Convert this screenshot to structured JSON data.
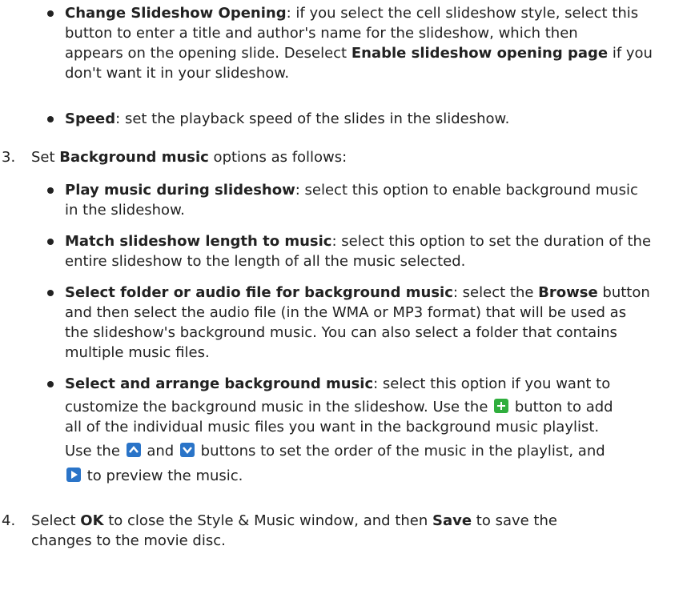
{
  "bullets": {
    "slideshow_opening": {
      "label": "Change Slideshow Opening",
      "line1": ": if you select the cell slideshow style, select this",
      "line2": "button to enter a title and author's name for the slideshow, which then",
      "line3a": "appears on the opening slide. Deselect ",
      "line3b": "Enable slideshow opening page",
      "line3c": " if you",
      "line4": "don't want it in your slideshow."
    },
    "speed": {
      "label": "Speed",
      "text": ": set the playback speed of the slides in the slideshow."
    },
    "play_music": {
      "label": "Play music during slideshow",
      "line1": ": select this option to enable background music",
      "line2": "in the slideshow."
    },
    "match_length": {
      "label": "Match slideshow length to music",
      "line1": ": select this option to set the duration of the",
      "line2": "entire slideshow to the length of all the music selected."
    },
    "select_folder": {
      "label": "Select folder or audio file for background music",
      "line1a": ": select the ",
      "line1b": "Browse",
      "line1c": " button",
      "line2": "and then select the audio file (in the WMA or MP3 format) that will be used as",
      "line3": "the slideshow's background music. You can also select a folder that contains",
      "line4": "multiple music files."
    },
    "arrange_music": {
      "label": "Select and arrange background music",
      "line1": ": select this option if you want to",
      "line2a": "customize the background music in the slideshow. Use the ",
      "line2b": " button to add",
      "line3": "all of the individual music files you want in the background music playlist.",
      "line4a": "Use the ",
      "line4b": " and ",
      "line4c": " buttons to set the order of the music in the playlist, and",
      "line5": " to preview the music."
    }
  },
  "steps": {
    "step3": {
      "number": "3.",
      "text_a": "Set ",
      "text_b": "Background music",
      "text_c": " options as follows:"
    },
    "step4": {
      "number": "4.",
      "line1a": "Select ",
      "line1b": "OK",
      "line1c": " to close the Style & Music window, and then ",
      "line1d": "Save",
      "line1e": " to save the",
      "line2": "changes to the movie disc."
    }
  },
  "icons": {
    "add": "plus-icon",
    "up": "chevron-up-icon",
    "down": "chevron-down-icon",
    "play": "play-icon"
  },
  "colors": {
    "text": "#222222",
    "add_button": "#2fae3d",
    "nav_buttons": "#2a74c8"
  }
}
